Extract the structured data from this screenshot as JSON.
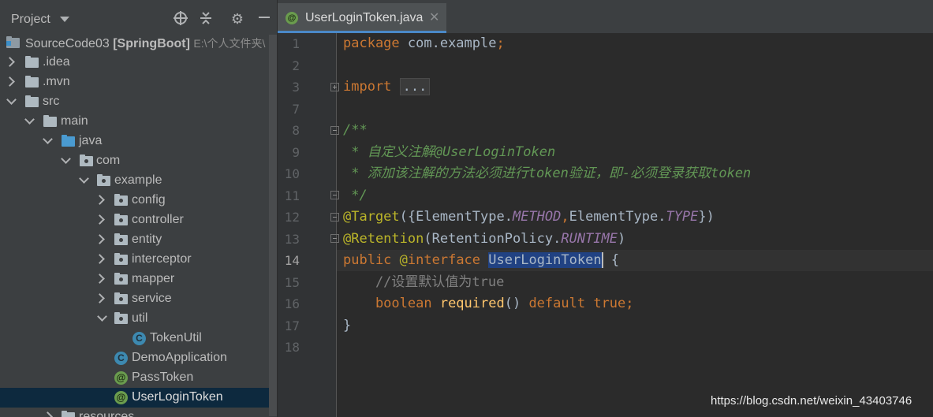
{
  "project_panel": {
    "title": "Project",
    "tree": [
      {
        "label": "SourceCode03",
        "bold": "[SpringBoot]",
        "path": "E:\\个人文件夹\\"
      },
      {
        "label": ".idea"
      },
      {
        "label": ".mvn"
      },
      {
        "label": "src"
      },
      {
        "label": "main"
      },
      {
        "label": "java"
      },
      {
        "label": "com"
      },
      {
        "label": "example"
      },
      {
        "label": "config"
      },
      {
        "label": "controller"
      },
      {
        "label": "entity"
      },
      {
        "label": "interceptor"
      },
      {
        "label": "mapper"
      },
      {
        "label": "service"
      },
      {
        "label": "util"
      },
      {
        "label": "TokenUtil"
      },
      {
        "label": "DemoApplication"
      },
      {
        "label": "PassToken"
      },
      {
        "label": "UserLoginToken"
      },
      {
        "label": "resources"
      }
    ]
  },
  "editor": {
    "tab_label": "UserLoginToken.java",
    "tab_icon": "@",
    "line_numbers": [
      "1",
      "2",
      "3",
      "7",
      "8",
      "9",
      "10",
      "11",
      "12",
      "13",
      "14",
      "15",
      "16",
      "17",
      "18"
    ],
    "current_line": "14",
    "code": {
      "l1_kw": "package",
      "l1_rest": " com.example",
      "l1_semi": ";",
      "l3_kw": "import",
      "l3_fold": "...",
      "l8": "/**",
      "l9": " * 自定义注解@UserLoginToken",
      "l10": " * 添加该注解的方法必须进行token验证，即-必须登录获取token",
      "l11": " */",
      "l12_ann": "@Target",
      "l12_a": "({ElementType.",
      "l12_s1": "METHOD",
      "l12_c": ",",
      "l12_b": "ElementType.",
      "l12_s2": "TYPE",
      "l12_e": "})",
      "l13_ann": "@Retention",
      "l13_a": "(RetentionPolicy.",
      "l13_s": "RUNTIME",
      "l13_e": ")",
      "l14_kw": "public",
      "l14_at": " @",
      "l14_iface": "interface",
      "l14_name": "UserLoginToken",
      "l14_brace": " {",
      "l15": "    //设置默认值为true",
      "l16_kw": "    boolean",
      "l16_m": " required",
      "l16_p": "() ",
      "l16_def": "default",
      "l16_true": " true;",
      "l17": "}"
    }
  },
  "watermark": "https://blog.csdn.net/weixin_43403746"
}
